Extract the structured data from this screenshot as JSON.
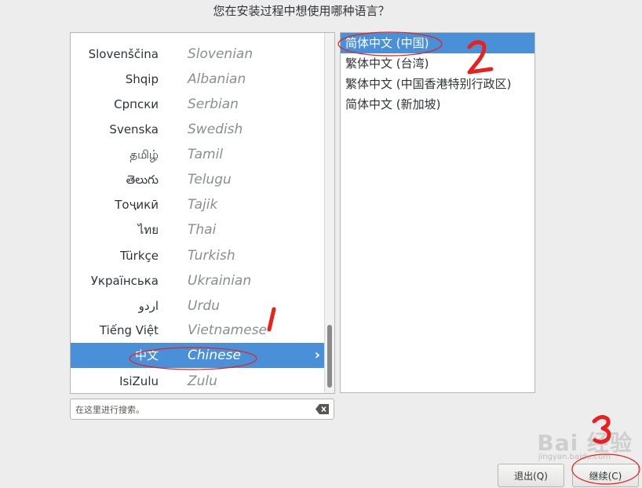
{
  "header": {
    "title": "您在安装过程中想使用哪种语言？"
  },
  "languages": [
    {
      "native": "Slovenščina",
      "english": "Slovenian"
    },
    {
      "native": "Shqip",
      "english": "Albanian"
    },
    {
      "native": "Српски",
      "english": "Serbian"
    },
    {
      "native": "Svenska",
      "english": "Swedish"
    },
    {
      "native": "தமிழ்",
      "english": "Tamil"
    },
    {
      "native": "తెలుగు",
      "english": "Telugu"
    },
    {
      "native": "Тоҷикӣ",
      "english": "Tajik"
    },
    {
      "native": "ไทย",
      "english": "Thai"
    },
    {
      "native": "Türkçe",
      "english": "Turkish"
    },
    {
      "native": "Українська",
      "english": "Ukrainian"
    },
    {
      "native": "اردو",
      "english": "Urdu"
    },
    {
      "native": "Tiếng Việt",
      "english": "Vietnamese"
    },
    {
      "native": "中文",
      "english": "Chinese",
      "selected": true
    },
    {
      "native": "IsiZulu",
      "english": "Zulu"
    }
  ],
  "locales": [
    {
      "label": "简体中文 (中国)",
      "selected": true
    },
    {
      "label": "繁体中文 (台湾)"
    },
    {
      "label": "繁体中文 (中国香港特别行政区)"
    },
    {
      "label": "简体中文 (新加坡)"
    }
  ],
  "search": {
    "placeholder": "在这里进行搜索。",
    "value": "",
    "clear_icon": "backspace-clear-icon"
  },
  "buttons": {
    "quit": "退出(Q)",
    "continue": "继续(C)"
  },
  "annotations": {
    "mark1": "1",
    "mark2": "2",
    "mark3": "3"
  },
  "watermark": {
    "brand": "Bai 经验",
    "sub": "jingyan.baidu.com"
  },
  "colors": {
    "selection": "#4a90d9",
    "annotation": "#e8201e"
  }
}
